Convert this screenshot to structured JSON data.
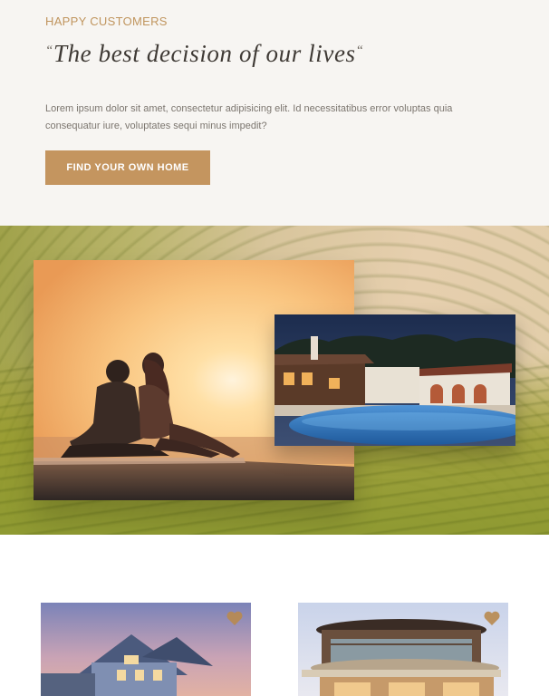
{
  "testimonial": {
    "eyebrow": "HAPPY CUSTOMERS",
    "open_quote": "“",
    "quote": "The best decision of our lives",
    "close_quote": "“",
    "body": "Lorem ipsum dolor sit amet, consectetur adipisicing elit. Id necessitatibus error voluptas quia consequatur iure, voluptates sequi minus impedit?",
    "cta_label": "FIND YOUR OWN HOME"
  },
  "hero": {
    "images": [
      {
        "name": "couple-sunset-photo"
      },
      {
        "name": "villa-pool-photo"
      }
    ]
  },
  "listings": {
    "cards": [
      {
        "name": "suburban-house-photo",
        "favorite_icon": "heart-icon"
      },
      {
        "name": "modern-round-building-photo",
        "favorite_icon": "heart-icon"
      }
    ]
  },
  "colors": {
    "accent": "#c4955f",
    "eyebrow": "#c0955e",
    "heading": "#3f3a35",
    "body_text": "#7c766f",
    "page_bg": "#f7f5f2"
  }
}
